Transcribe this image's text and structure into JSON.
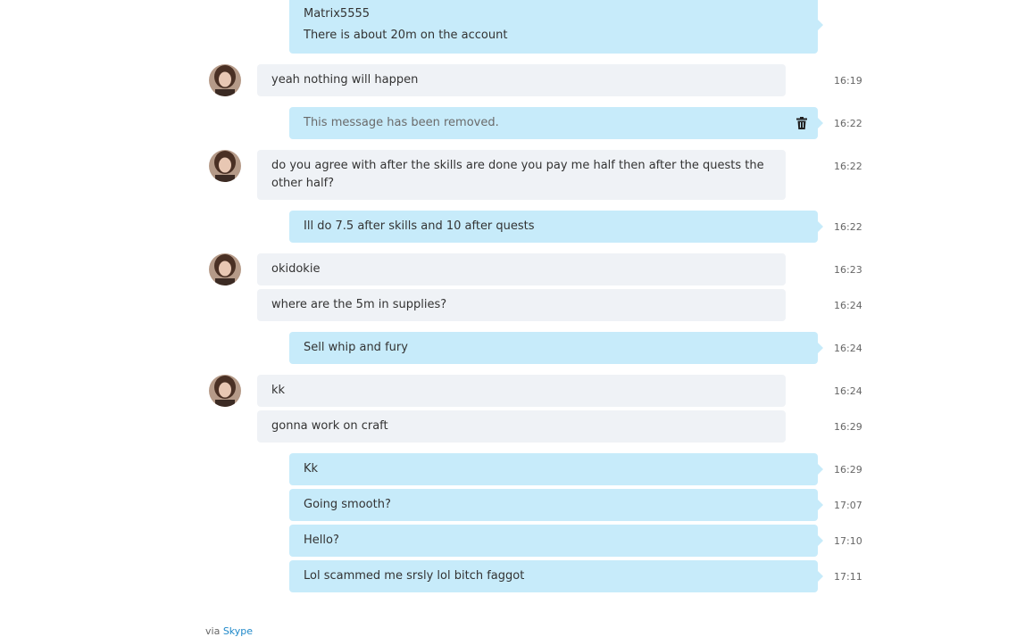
{
  "messages": [
    {
      "id": "m1",
      "dir": "out",
      "sender": "Matrix5555",
      "text": "There is about 20m on the account",
      "time": ""
    },
    {
      "id": "m2",
      "dir": "in",
      "avatar": true,
      "text": "yeah nothing will happen",
      "time": "16:19"
    },
    {
      "id": "m3",
      "dir": "out",
      "removed": true,
      "text": "This message has been removed.",
      "time": "16:22"
    },
    {
      "id": "m4",
      "dir": "in",
      "avatar": true,
      "text": "do you agree with after the skills are done you pay me half then after the quests the other half?",
      "time": "16:22"
    },
    {
      "id": "m5",
      "dir": "out",
      "text": "Ill do 7.5 after skills and 10 after quests",
      "time": "16:22"
    },
    {
      "id": "m6",
      "dir": "in",
      "avatar": true,
      "text": "okidokie",
      "time": "16:23"
    },
    {
      "id": "m7",
      "dir": "in",
      "text": "where are the 5m in supplies?",
      "time": "16:24"
    },
    {
      "id": "m8",
      "dir": "out",
      "text": "Sell whip and fury",
      "time": "16:24"
    },
    {
      "id": "m9",
      "dir": "in",
      "avatar": true,
      "text": "kk",
      "time": "16:24"
    },
    {
      "id": "m10",
      "dir": "in",
      "text": "gonna work on craft",
      "time": "16:29"
    },
    {
      "id": "m11",
      "dir": "out",
      "text": "Kk",
      "time": "16:29"
    },
    {
      "id": "m12",
      "dir": "out",
      "text": "Going smooth?",
      "time": "17:07"
    },
    {
      "id": "m13",
      "dir": "out",
      "text": "Hello?",
      "time": "17:10"
    },
    {
      "id": "m14",
      "dir": "out",
      "text": "Lol scammed me srsly lol bitch faggot",
      "time": "17:11"
    }
  ],
  "footer": {
    "prefix": "via",
    "link": "Skype"
  },
  "colors": {
    "incoming": "#eff2f6",
    "outgoing": "#c7ebfa",
    "link": "#1e88c9"
  }
}
